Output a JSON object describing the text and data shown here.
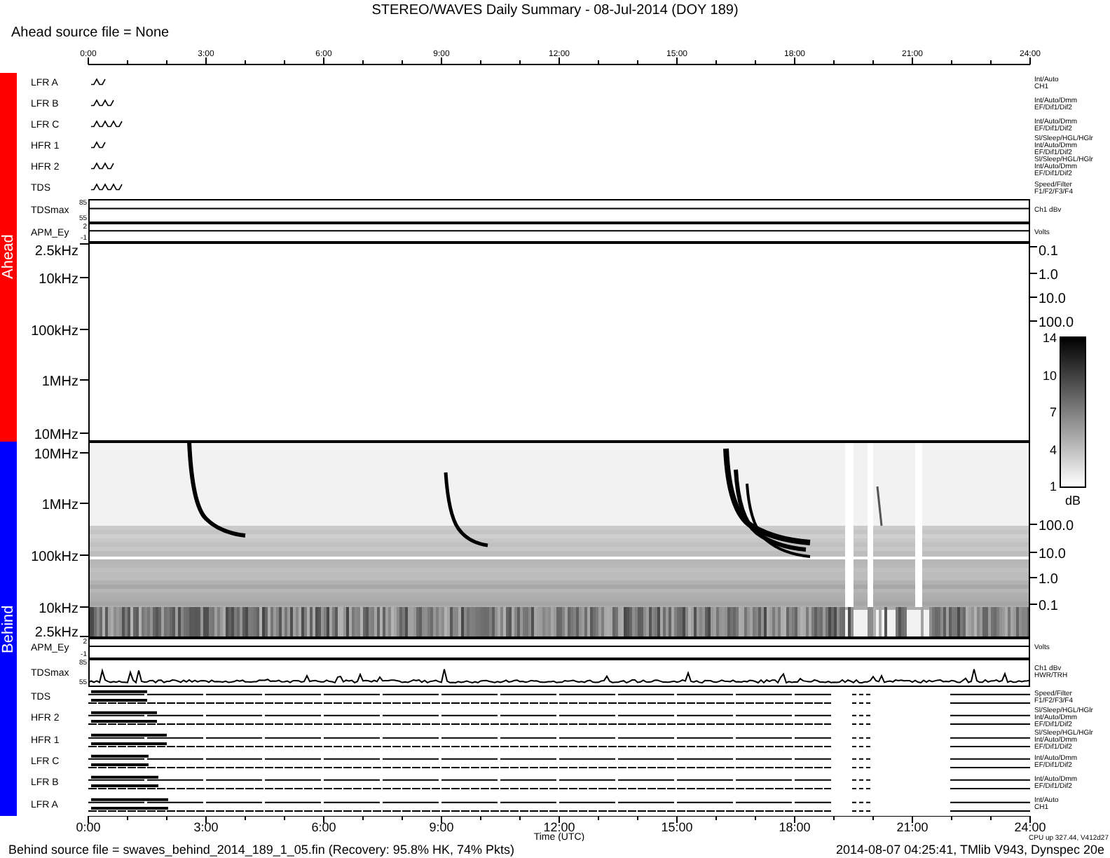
{
  "title": "STEREO/WAVES Daily Summary - 08-Jul-2014 (DOY 189)",
  "ahead_source": "Ahead source file = None",
  "top_axis": {
    "labels": [
      "0:00",
      "3:00",
      "6:00",
      "9:00",
      "12:00",
      "15:00",
      "18:00",
      "21:00",
      "24:00"
    ]
  },
  "ahead": {
    "label": "Ahead",
    "instruments": [
      {
        "name": "LFR A",
        "mode": [
          "Int/Auto",
          "CH1"
        ]
      },
      {
        "name": "LFR B",
        "mode": [
          "Int/Auto/Dmm",
          "EF/Dif1/Dif2"
        ]
      },
      {
        "name": "LFR C",
        "mode": [
          "Int/Auto/Dmm",
          "EF/Dif1/Dif2"
        ]
      },
      {
        "name": "HFR 1",
        "mode": [
          "Sl/Sleep/HGL/HGlr",
          "Int/Auto/Dmm",
          "EF/Dif1/Dif2"
        ]
      },
      {
        "name": "HFR 2",
        "mode": [
          "Sl/Sleep/HGL/HGlr",
          "Int/Auto/Dmm",
          "EF/Dif1/Dif2"
        ]
      },
      {
        "name": "TDS",
        "mode": [
          "Speed/Filter",
          "F1/F2/F3/F4"
        ]
      }
    ],
    "tdsmax": {
      "name": "TDSmax",
      "ticks": [
        "85",
        "55"
      ],
      "unit": [
        "Ch1 dBv"
      ]
    },
    "apm": {
      "name": "APM_Ey",
      "ticks": [
        "2",
        "-1"
      ],
      "unit": [
        "Volts"
      ]
    },
    "spectrogram": {
      "freq_ticks": [
        "2.5kHz",
        "10kHz",
        "100kHz",
        "1MHz",
        "10MHz"
      ],
      "right_ticks": [
        "0.1",
        "1.0",
        "10.0",
        "100.0"
      ]
    }
  },
  "colorbar": {
    "ticks": [
      "14",
      "10",
      "7",
      "4",
      "1"
    ],
    "unit": "dB"
  },
  "behind": {
    "label": "Behind",
    "spectrogram": {
      "freq_ticks": [
        "10MHz",
        "1MHz",
        "100kHz",
        "10kHz",
        "2.5kHz"
      ],
      "right_ticks": [
        "100.0",
        "10.0",
        "1.0",
        "0.1"
      ]
    },
    "apm": {
      "name": "APM_Ey",
      "ticks": [
        "2",
        "-1"
      ],
      "unit": [
        "Volts"
      ]
    },
    "tdsmax": {
      "name": "TDSmax",
      "ticks": [
        "85",
        "55"
      ],
      "unit": [
        "Ch1 dBv",
        "HWR/TRH"
      ]
    },
    "instruments": [
      {
        "name": "TDS",
        "mode": [
          "Speed/Filter",
          "F1/F2/F3/F4"
        ]
      },
      {
        "name": "HFR 2",
        "mode": [
          "Sl/Sleep/HGL/HGlr",
          "Int/Auto/Dmm",
          "EF/Dif1/Dif2"
        ]
      },
      {
        "name": "HFR 1",
        "mode": [
          "Sl/Sleep/HGL/HGlr",
          "Int/Auto/Dmm",
          "EF/Dif1/Dif2"
        ]
      },
      {
        "name": "LFR C",
        "mode": [
          "Int/Auto/Dmm",
          "EF/Dif1/Dif2"
        ]
      },
      {
        "name": "LFR B",
        "mode": [
          "Int/Auto/Dmm",
          "EF/Dif1/Dif2"
        ]
      },
      {
        "name": "LFR A",
        "mode": [
          "Int/Auto",
          "CH1"
        ]
      }
    ]
  },
  "bottom_axis": {
    "labels": [
      "0:00",
      "3:00",
      "6:00",
      "9:00",
      "12:00",
      "15:00",
      "18:00",
      "21:00",
      "24:00"
    ],
    "title": "Time (UTC)",
    "cpu": "CPU up 327.44, V412d27"
  },
  "footer": {
    "source": "Behind source file = swaves_behind_2014_189_1_05.fin (Recovery: 95.8% HK, 74% Pkts)",
    "build": "2014-08-07 04:25:41, TMlib V943, Dynspec 20e"
  }
}
